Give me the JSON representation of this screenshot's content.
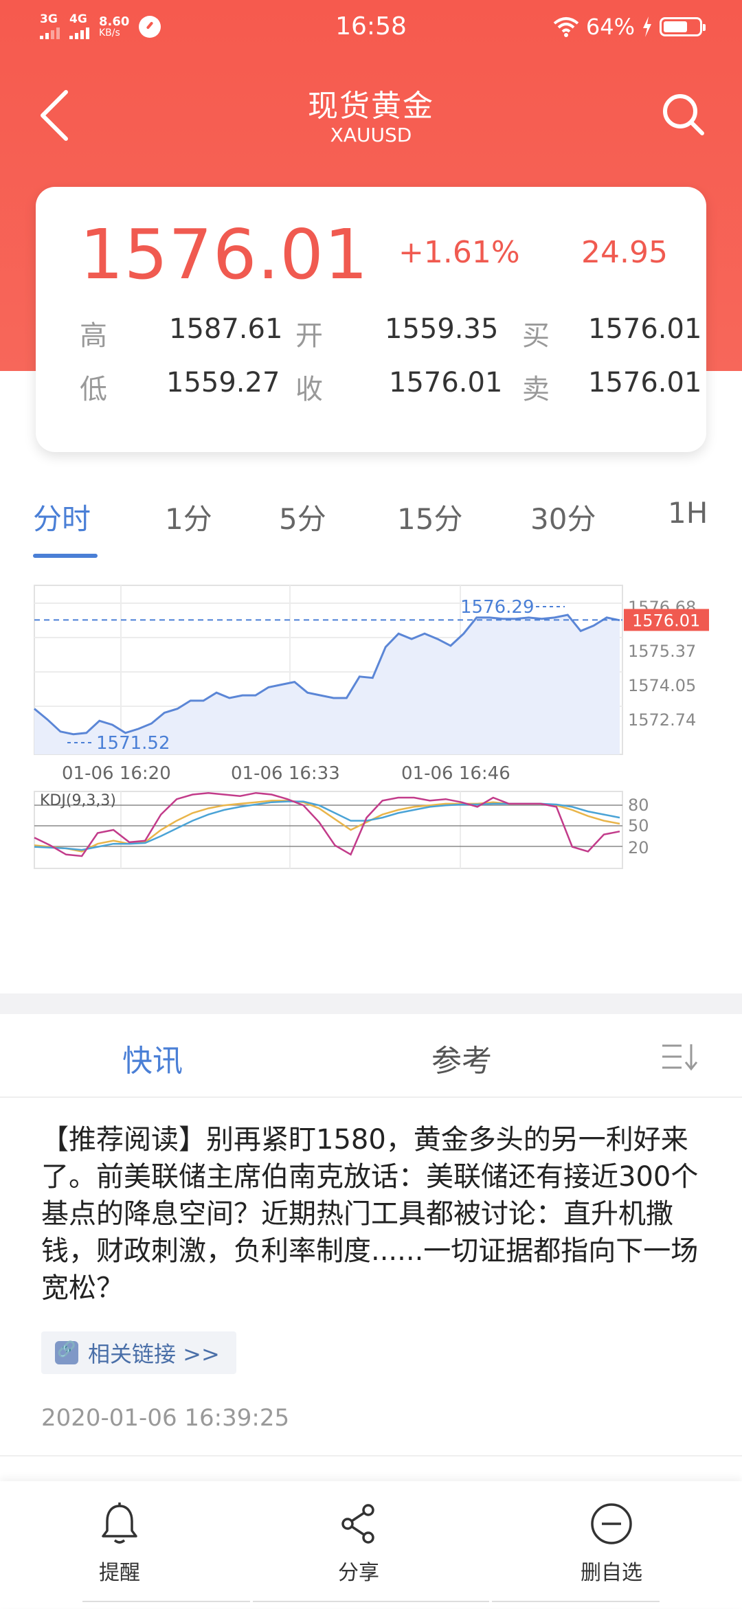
{
  "status_bar": {
    "sig1": "3G",
    "sig2": "4G",
    "speed_value": "8.60",
    "speed_unit": "KB/s",
    "time": "16:58",
    "battery": "64%"
  },
  "nav": {
    "title": "现货黄金",
    "subtitle": "XAUUSD"
  },
  "quote": {
    "price": "1576.01",
    "change_pct": "+1.61%",
    "change": "24.95",
    "high_label": "高",
    "high": "1587.61",
    "open_label": "开",
    "open": "1559.35",
    "buy_label": "买",
    "buy": "1576.01",
    "low_label": "低",
    "low": "1559.27",
    "close_label": "收",
    "close": "1576.01",
    "sell_label": "卖",
    "sell": "1576.01"
  },
  "tabs": [
    "分时",
    "1分",
    "5分",
    "15分",
    "30分",
    "1H"
  ],
  "chart_data": {
    "type": "line",
    "y_ticks": [
      "1576.68",
      "1575.37",
      "1574.05",
      "1572.74"
    ],
    "current_price_label": "1576.01",
    "high_marker": "1576.29",
    "low_marker": "1571.52",
    "x_ticks": [
      "01-06 16:20",
      "01-06 16:33",
      "01-06 16:46"
    ],
    "ylim": [
      1571.0,
      1577.3
    ],
    "values": [
      1572.7,
      1572.3,
      1571.85,
      1571.75,
      1571.8,
      1572.25,
      1572.1,
      1571.8,
      1571.95,
      1572.15,
      1572.55,
      1572.7,
      1573.0,
      1573.0,
      1573.3,
      1573.1,
      1573.2,
      1573.2,
      1573.5,
      1573.6,
      1573.7,
      1573.3,
      1573.2,
      1573.1,
      1573.1,
      1573.9,
      1573.85,
      1575.0,
      1575.5,
      1575.3,
      1575.5,
      1575.3,
      1575.05,
      1575.5,
      1576.1,
      1576.1,
      1576.05,
      1576.05,
      1576.1,
      1576.05,
      1576.1,
      1576.2,
      1575.6,
      1575.8,
      1576.1,
      1576.0
    ],
    "kdj": {
      "label": "KDJ(9,3,3)",
      "y_ticks": [
        "80",
        "50",
        "20"
      ],
      "ylim": [
        0,
        100
      ],
      "K": [
        30,
        28,
        26,
        22,
        32,
        36,
        32,
        34,
        50,
        62,
        72,
        78,
        82,
        84,
        86,
        88,
        88,
        86,
        78,
        64,
        50,
        60,
        70,
        76,
        80,
        82,
        84,
        84,
        84,
        86,
        84,
        84,
        84,
        82,
        76,
        68,
        62,
        58
      ],
      "D": [
        28,
        27,
        26,
        24,
        28,
        32,
        32,
        33,
        42,
        52,
        62,
        70,
        76,
        80,
        83,
        86,
        87,
        87,
        82,
        72,
        62,
        62,
        66,
        72,
        76,
        80,
        82,
        83,
        83,
        84,
        84,
        84,
        84,
        83,
        80,
        74,
        70,
        66
      ],
      "J": [
        40,
        30,
        18,
        16,
        46,
        50,
        34,
        36,
        70,
        90,
        96,
        98,
        96,
        94,
        98,
        96,
        90,
        82,
        60,
        30,
        18,
        66,
        88,
        92,
        92,
        88,
        90,
        86,
        80,
        92,
        84,
        84,
        84,
        80,
        28,
        22,
        44,
        48
      ]
    }
  },
  "news": {
    "tabs": [
      "快讯",
      "参考"
    ],
    "text": "【推荐阅读】别再紧盯1580，黄金多头的另一利好来了。前美联储主席伯南克放话：美联储还有接近300个基点的降息空间？近期热门工具都被讨论：直升机撒钱，财政刺激，负利率制度......一切证据都指向下一场宽松？",
    "link": "相关链接 >>",
    "time": "2020-01-06 16:39:25"
  },
  "bottom": {
    "remind": "提醒",
    "share": "分享",
    "remove": "删自选"
  },
  "colors": {
    "header": "#f65a4e",
    "accent_red": "#f05a50",
    "accent_blue": "#4a7fd6",
    "kdj_k": "#e9b54a",
    "kdj_d": "#4aa3d6",
    "kdj_j": "#c23b8a"
  }
}
